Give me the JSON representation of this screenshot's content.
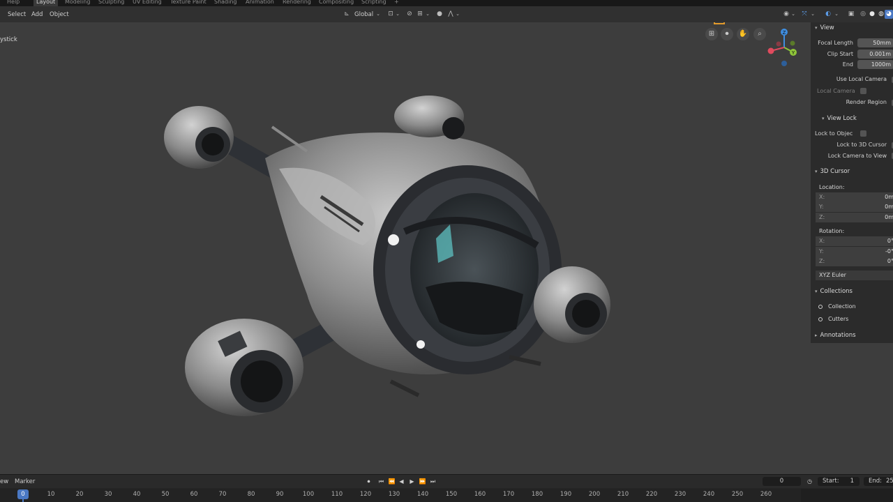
{
  "workspace_tabs": [
    "Help",
    "Layout",
    "Modeling",
    "Sculpting",
    "UV Editing",
    "Texture Paint",
    "Shading",
    "Animation",
    "Rendering",
    "Compositing",
    "Scripting",
    "+"
  ],
  "header": {
    "select": "Select",
    "add": "Add",
    "object": "Object",
    "orientation": "Global"
  },
  "viewport": {
    "object_label": "ystick",
    "gizmo_axes": {
      "z": "Z",
      "y": "Y"
    }
  },
  "sidebar": {
    "view": {
      "title": "View",
      "focal_length_label": "Focal Length",
      "focal_length": "50mm",
      "clip_start_label": "Clip Start",
      "clip_start": "0.001m",
      "end_label": "End",
      "end": "1000m",
      "use_local_camera": "Use Local Camera",
      "local_camera": "Local Camera",
      "render_region": "Render Region"
    },
    "view_lock": {
      "title": "View Lock",
      "lock_to_object": "Lock to Objec",
      "lock_to_3d_cursor": "Lock to 3D Cursor",
      "lock_camera_to_view": "Lock Camera to View"
    },
    "cursor": {
      "title": "3D Cursor",
      "location_label": "Location:",
      "location": [
        {
          "axis": "X:",
          "value": "0m"
        },
        {
          "axis": "Y:",
          "value": "0m"
        },
        {
          "axis": "Z:",
          "value": "0m"
        }
      ],
      "rotation_label": "Rotation:",
      "rotation": [
        {
          "axis": "X:",
          "value": "0°"
        },
        {
          "axis": "Y:",
          "value": "-0°"
        },
        {
          "axis": "Z:",
          "value": "0°"
        }
      ],
      "rotation_mode": "XYZ Euler"
    },
    "collections": {
      "title": "Collections",
      "items": [
        "Collection",
        "Cutters"
      ]
    },
    "annotations": {
      "title": "Annotations"
    }
  },
  "timeline": {
    "view": "ew",
    "marker": "Marker",
    "current_frame": "0",
    "start_label": "Start:",
    "start": "1",
    "end_label": "End:",
    "end": "25",
    "playhead": "0",
    "ticks": [
      "10",
      "20",
      "30",
      "40",
      "50",
      "60",
      "70",
      "80",
      "90",
      "100",
      "110",
      "120",
      "130",
      "140",
      "150",
      "160",
      "170",
      "180",
      "190",
      "200",
      "210",
      "220",
      "230",
      "240",
      "250",
      "260"
    ]
  },
  "colors": {
    "accent_blue": "#4a78c3",
    "camera_orange": "#e29a2c",
    "axis_x": "#e04b5e",
    "axis_y": "#8fc63a",
    "axis_z": "#3f8ee0"
  }
}
